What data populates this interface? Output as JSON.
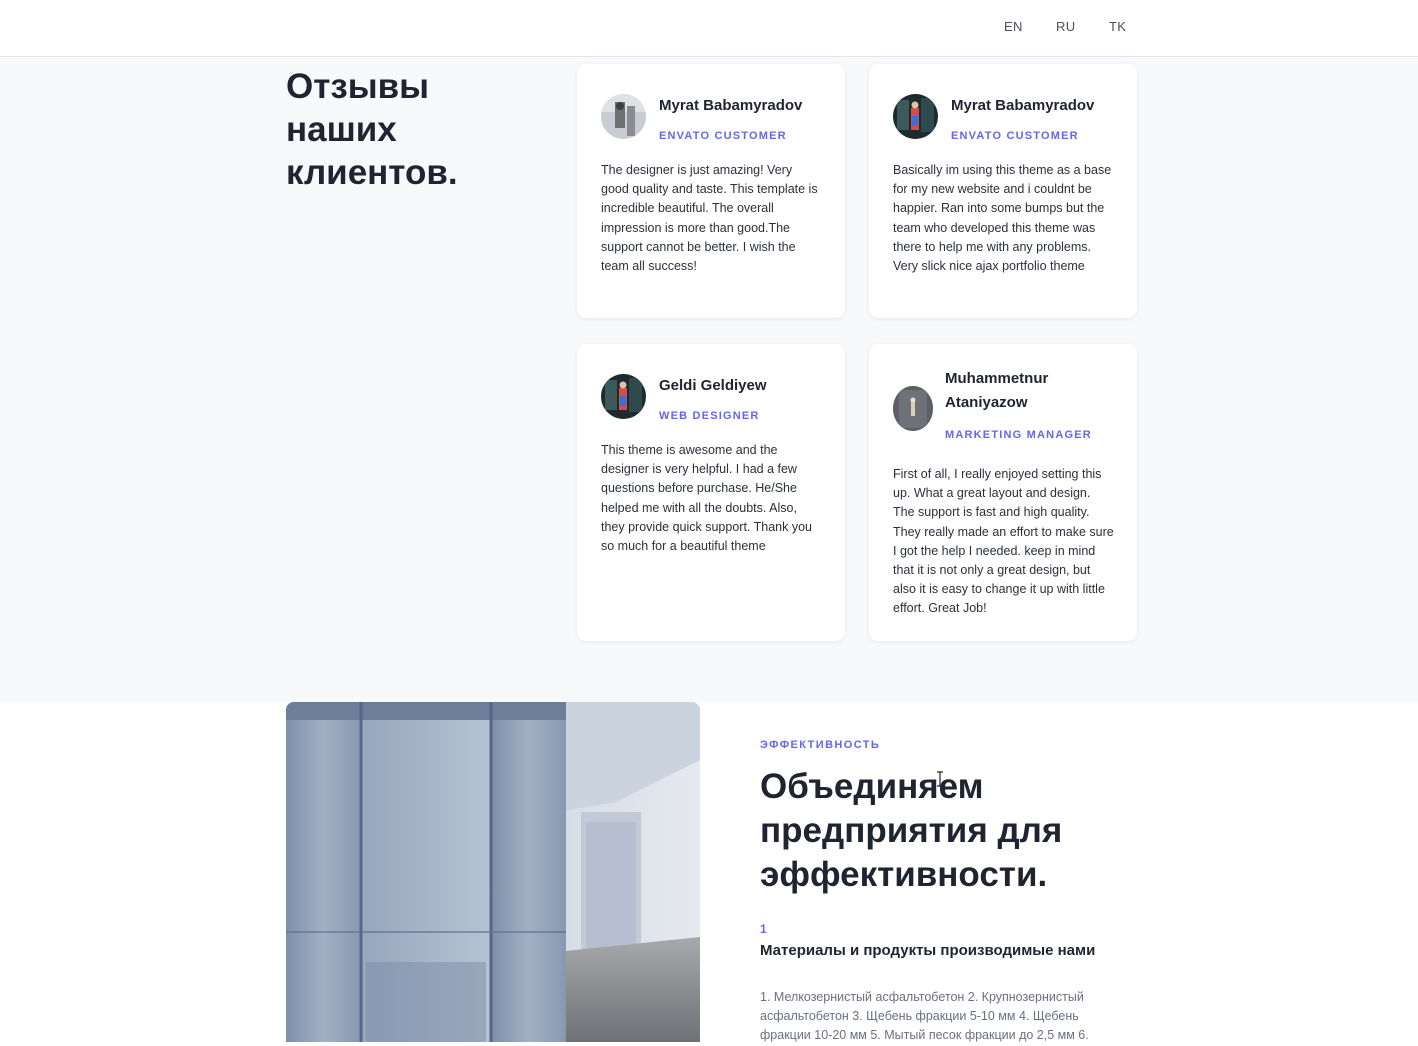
{
  "header": {
    "languages": [
      "EN",
      "RU",
      "TK"
    ]
  },
  "reviews": {
    "title": "Отзывы наших клиентов.",
    "items": [
      {
        "name": "Myrat Babamyradov",
        "role": "ENVATO CUSTOMER",
        "text": "The designer is just amazing! Very good quality and taste. This template is incredible beautiful. The overall impression is more than good.The support cannot be better. I wish the team all success!"
      },
      {
        "name": "Myrat Babamyradov",
        "role": "ENVATO CUSTOMER",
        "text": "Basically im using this theme as a base for my new website and i couldnt be happier. Ran into some bumps but the team who developed this theme was there to help me with any problems. Very slick nice ajax portfolio theme"
      },
      {
        "name": "Geldi Geldiyew",
        "role": "WEB DESIGNER",
        "text": "This theme is awesome and the designer is very helpful. I had a few questions before purchase. He/She helped me with all the doubts. Also, they provide quick support. Thank you so much for a beautiful theme"
      },
      {
        "name": "Muhammetnur Ataniyazow",
        "role": "MARKETING MANAGER",
        "text": "First of all, I really enjoyed setting this up. What a great layout and design. The support is fast and high quality. They really made an effort to make sure I got the help I needed. keep in mind that it is not only a great design, but also it is easy to change it up with little effort. Great Job!"
      }
    ]
  },
  "efficiency": {
    "eyebrow": "ЭФФЕКТИВНОСТЬ",
    "title": "Объединяем предприятия для эффективности.",
    "step_number": "1",
    "step_title": "Материалы и продукты производимые нами",
    "step_text": "1. Мелкозернистый асфальтобетон 2. Крупнозернистый асфальтобетон 3. Щебень фракции 5-10 мм 4. Щебень фракции 10-20 мм 5. Мытый песок фракции до 2,5 мм 6."
  },
  "colors": {
    "accent": "#6366f1",
    "text": "#1f2430",
    "section_bg": "#f8f9fb"
  }
}
